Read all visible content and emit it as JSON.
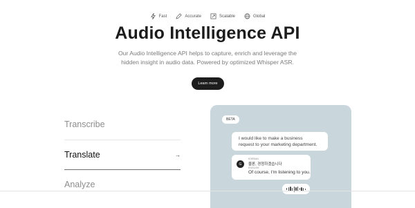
{
  "features": [
    {
      "icon": "lightning-icon",
      "label": "Fast"
    },
    {
      "icon": "pen-icon",
      "label": "Accurate"
    },
    {
      "icon": "scale-icon",
      "label": "Scalable"
    },
    {
      "icon": "globe-icon",
      "label": "Global"
    }
  ],
  "hero": {
    "title": "Audio Intelligence API",
    "description_line1": "Our Audio Intelligence API helps to capture, enrich and leverage the",
    "description_line2": "hidden insight in audio data. Powered by optimized Whisper ASR.",
    "cta_label": "Learn more"
  },
  "menu": {
    "items": [
      {
        "label": "Transcribe"
      },
      {
        "label": "Translate",
        "arrow": "→"
      },
      {
        "label": "Analyze"
      }
    ]
  },
  "demo": {
    "badge": "BETA",
    "bubble1_line1": "I would like to make a business",
    "bubble1_line2": "request to your marketing department.",
    "avatar_initial": "G",
    "lang_from": "KOREAN",
    "korean_text": "물론, 경청하겠습니다",
    "lang_to": "ENGLISH",
    "english_text": "Of course, I'm listening to you."
  }
}
